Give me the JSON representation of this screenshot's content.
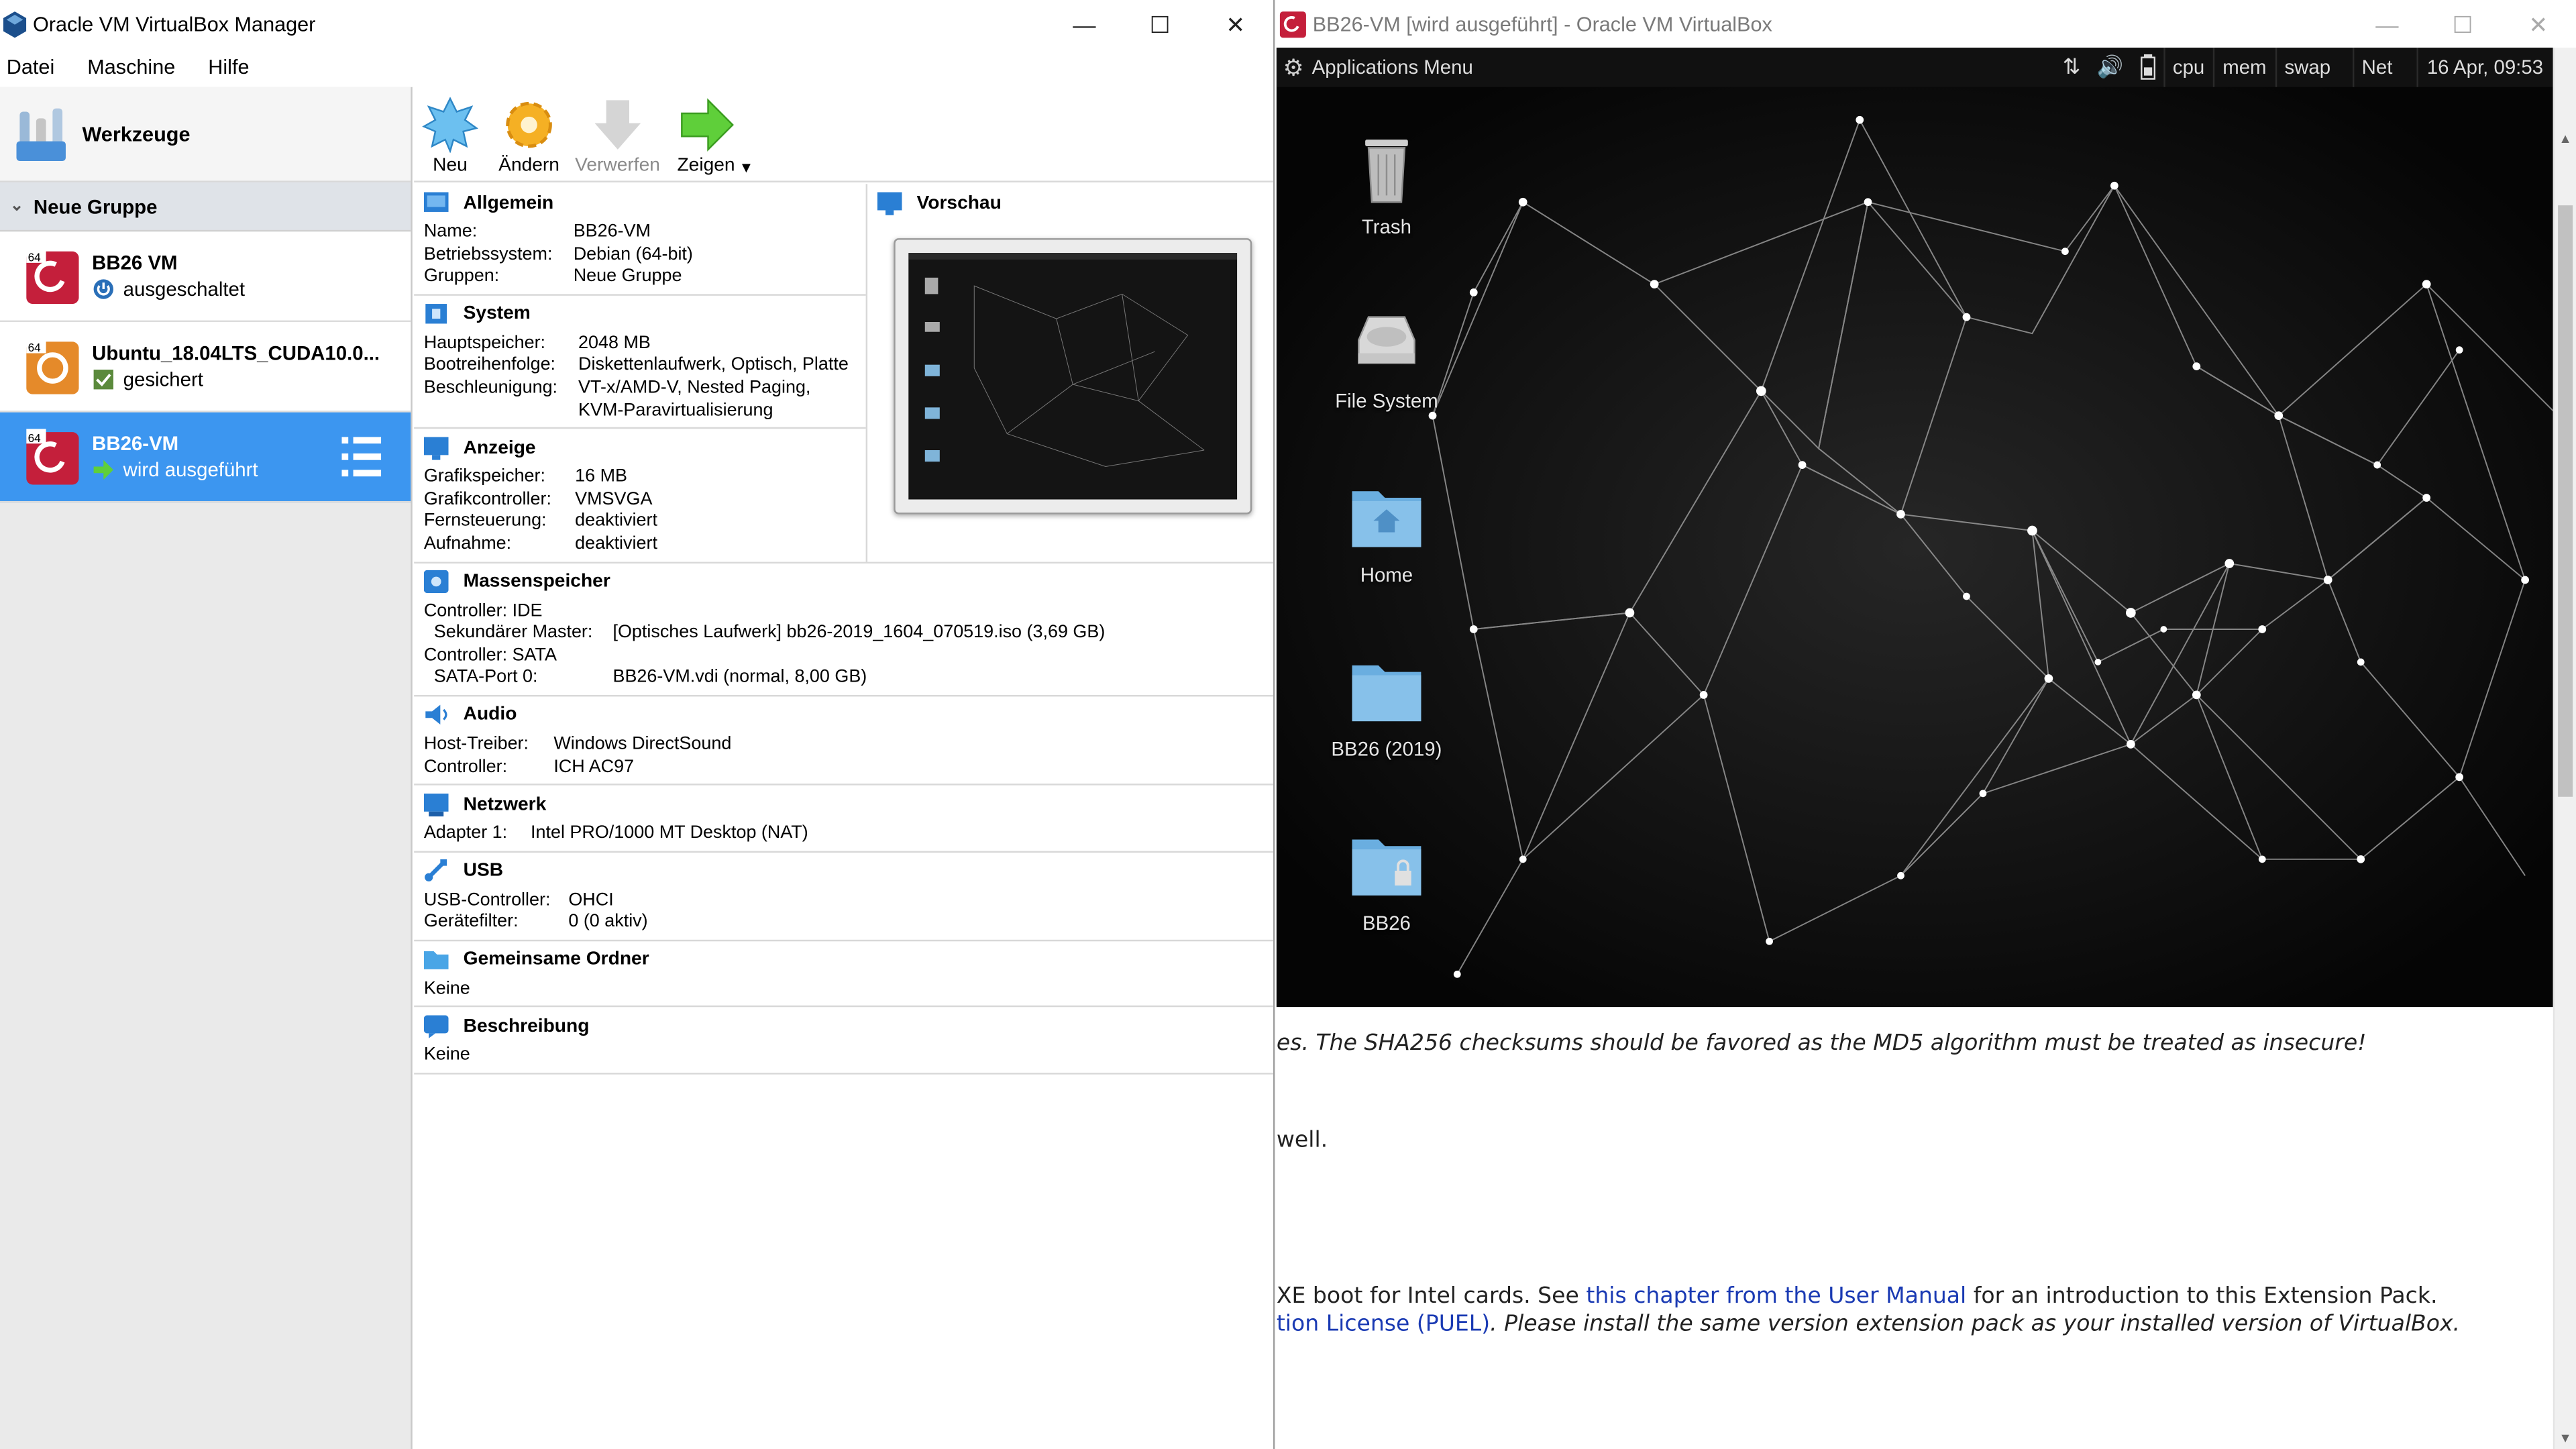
{
  "manager": {
    "title": "Oracle VM VirtualBox Manager",
    "menu": [
      "Datei",
      "Maschine",
      "Hilfe"
    ],
    "tools_label": "Werkzeuge",
    "group_name": "Neue Gruppe",
    "vms": [
      {
        "name": "BB26 VM",
        "state": "ausgeschaltet",
        "badge": "64"
      },
      {
        "name": "Ubuntu_18.04LTS_CUDA10.0...",
        "state": "gesichert",
        "badge": "64"
      },
      {
        "name": "BB26-VM",
        "state": "wird ausgeführt",
        "badge": "64"
      }
    ],
    "toolbar": {
      "new": "Neu",
      "change": "Ändern",
      "discard": "Verwerfen",
      "show": "Zeigen"
    },
    "details": {
      "general": {
        "title": "Allgemein",
        "rows": [
          [
            "Name:",
            "BB26-VM"
          ],
          [
            "Betriebssystem:",
            "Debian (64-bit)"
          ],
          [
            "Gruppen:",
            "Neue Gruppe"
          ]
        ]
      },
      "system": {
        "title": "System",
        "rows": [
          [
            "Hauptspeicher:",
            "2048 MB"
          ],
          [
            "Bootreihenfolge:",
            "Diskettenlaufwerk, Optisch, Platte"
          ],
          [
            "Beschleunigung:",
            "VT-x/AMD-V, Nested Paging,"
          ],
          [
            "",
            "KVM-Paravirtualisierung"
          ]
        ]
      },
      "display": {
        "title": "Anzeige",
        "rows": [
          [
            "Grafikspeicher:",
            "16 MB"
          ],
          [
            "Grafikcontroller:",
            "VMSVGA"
          ],
          [
            "Fernsteuerung:",
            "deaktiviert"
          ],
          [
            "Aufnahme:",
            "deaktiviert"
          ]
        ]
      },
      "preview": {
        "title": "Vorschau"
      },
      "storage": {
        "title": "Massenspeicher",
        "rows": [
          [
            "Controller: IDE",
            ""
          ],
          [
            "  Sekundärer Master:",
            "[Optisches Laufwerk] bb26-2019_1604_070519.iso (3,69 GB)"
          ],
          [
            "Controller: SATA",
            ""
          ],
          [
            "  SATA-Port 0:",
            "BB26-VM.vdi (normal, 8,00 GB)"
          ]
        ]
      },
      "audio": {
        "title": "Audio",
        "rows": [
          [
            "Host-Treiber:",
            "Windows DirectSound"
          ],
          [
            "Controller:",
            "ICH AC97"
          ]
        ]
      },
      "network": {
        "title": "Netzwerk",
        "rows": [
          [
            "Adapter 1:",
            "Intel PRO/1000 MT Desktop (NAT)"
          ]
        ]
      },
      "usb": {
        "title": "USB",
        "rows": [
          [
            "USB-Controller:",
            "OHCI"
          ],
          [
            "Gerätefilter:",
            "0 (0 aktiv)"
          ]
        ]
      },
      "shared": {
        "title": "Gemeinsame Ordner",
        "value": "Keine"
      },
      "description": {
        "title": "Beschreibung",
        "value": "Keine"
      }
    }
  },
  "vmwindow": {
    "title": "BB26-VM [wird ausgeführt] - Oracle VM VirtualBox",
    "panel": {
      "apps_menu": "Applications Menu",
      "items": [
        "cpu",
        "mem",
        "swap",
        "Net"
      ],
      "clock": "16 Apr, 09:53"
    },
    "desktop_icons": [
      "Trash",
      "File System",
      "Home",
      "BB26 (2019)",
      "BB26"
    ]
  },
  "browser": {
    "line1": "es. The SHA256 checksums should be favored as the MD5 algorithm must be treated as insecure!",
    "line2": "well.",
    "line3_pre": "XE boot for Intel cards. See ",
    "line3_link": "this chapter from the User Manual",
    "line3_post": " for an introduction to this Extension Pack.",
    "line4_link": "tion License (PUEL)",
    "line4_post": ". Please install the same version extension pack as your installed version of VirtualBox."
  }
}
